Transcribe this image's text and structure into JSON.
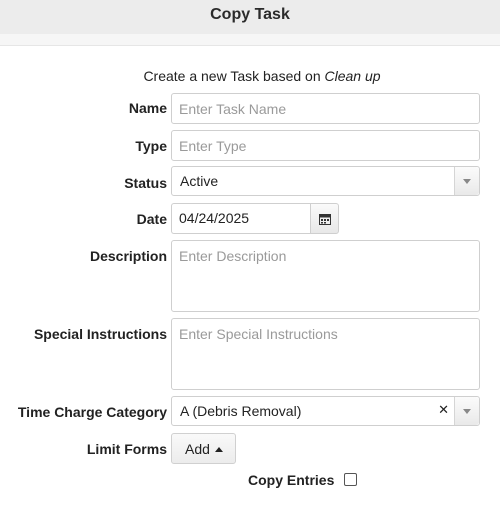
{
  "header": {
    "title": "Copy Task"
  },
  "intro": {
    "prefix": "Create a new Task based on ",
    "task_name": "Clean up"
  },
  "form": {
    "name": {
      "label": "Name",
      "placeholder": "Enter Task Name",
      "value": ""
    },
    "type": {
      "label": "Type",
      "placeholder": "Enter Type",
      "value": ""
    },
    "status": {
      "label": "Status",
      "value": "Active"
    },
    "date": {
      "label": "Date",
      "value": "04/24/2025"
    },
    "description": {
      "label": "Description",
      "placeholder": "Enter Description",
      "value": ""
    },
    "special_instructions": {
      "label": "Special Instructions",
      "placeholder": "Enter Special Instructions",
      "value": ""
    },
    "time_charge_category": {
      "label": "Time Charge Category",
      "value": "A (Debris Removal)"
    },
    "limit_forms": {
      "label": "Limit Forms",
      "button_label": "Add"
    },
    "copy_entries": {
      "label": "Copy Entries",
      "checked": false
    }
  },
  "icons": {
    "date_picker": "calendar-icon",
    "status_dropdown": "chevron-down-icon",
    "clear": "close-icon",
    "add_menu": "caret-up-icon"
  }
}
